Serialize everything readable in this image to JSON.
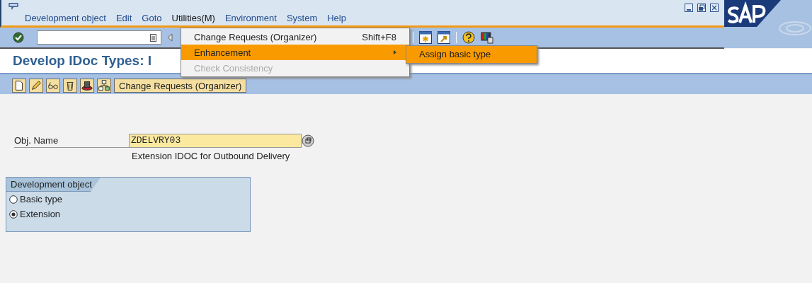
{
  "menu_bar": {
    "items": [
      {
        "label": "Development object",
        "selected": false
      },
      {
        "label": "Edit",
        "selected": false
      },
      {
        "label": "Goto",
        "selected": false
      },
      {
        "label": "Utilities(M)",
        "selected": true
      },
      {
        "label": "Environment",
        "selected": false
      },
      {
        "label": "System",
        "selected": false
      },
      {
        "label": "Help",
        "selected": false
      }
    ]
  },
  "dropdown": {
    "items": [
      {
        "label": "Change Requests (Organizer)",
        "shortcut": "Shift+F8",
        "kind": "item",
        "selected": false,
        "disabled": false
      },
      {
        "label": "Enhancement",
        "kind": "submenu",
        "selected": true,
        "disabled": false
      },
      {
        "label": "Check Consistency",
        "kind": "item",
        "selected": false,
        "disabled": true
      }
    ]
  },
  "submenu": {
    "items": [
      {
        "label": "Assign basic type",
        "selected": true
      }
    ]
  },
  "title": "Develop IDoc Types: I",
  "application_toolbar": {
    "button": "Change Requests (Organizer)"
  },
  "form": {
    "label": "Obj. Name",
    "value": "ZDELVRY03",
    "description": "Extension IDOC for Outbound Delivery"
  },
  "group": {
    "title": "Development object",
    "options": [
      {
        "label": "Basic type",
        "selected": false
      },
      {
        "label": "Extension",
        "selected": true
      }
    ]
  }
}
